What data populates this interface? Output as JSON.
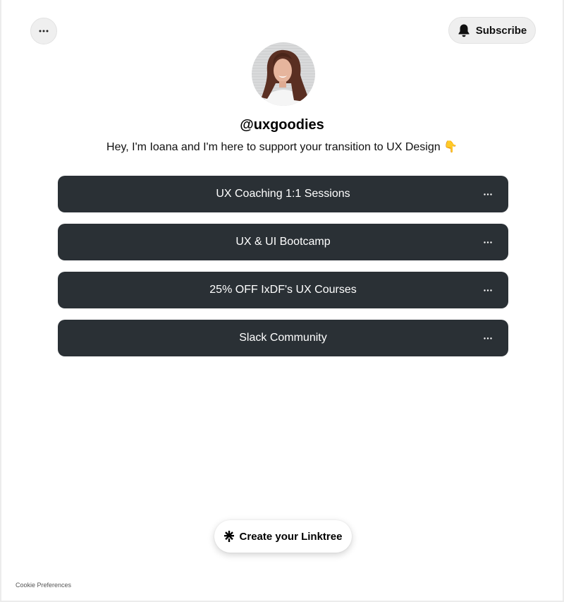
{
  "header": {
    "more_icon": "more-horizontal-icon",
    "subscribe_label": "Subscribe",
    "subscribe_icon": "bell-icon"
  },
  "profile": {
    "username": "@uxgoodies",
    "bio": "Hey, I'm Ioana and I'm here to support your transition to UX Design 👇"
  },
  "links": [
    {
      "label": "UX Coaching 1:1 Sessions"
    },
    {
      "label": "UX & UI Bootcamp"
    },
    {
      "label": "25% OFF IxDF's UX Courses"
    },
    {
      "label": "Slack Community"
    }
  ],
  "footer": {
    "create_label": "Create your Linktree",
    "create_icon": "linktree-logo-icon",
    "cookie_label": "Cookie Preferences"
  },
  "colors": {
    "link_background": "#2a3035",
    "link_text": "#ffffff",
    "pill_background": "#efefef"
  }
}
